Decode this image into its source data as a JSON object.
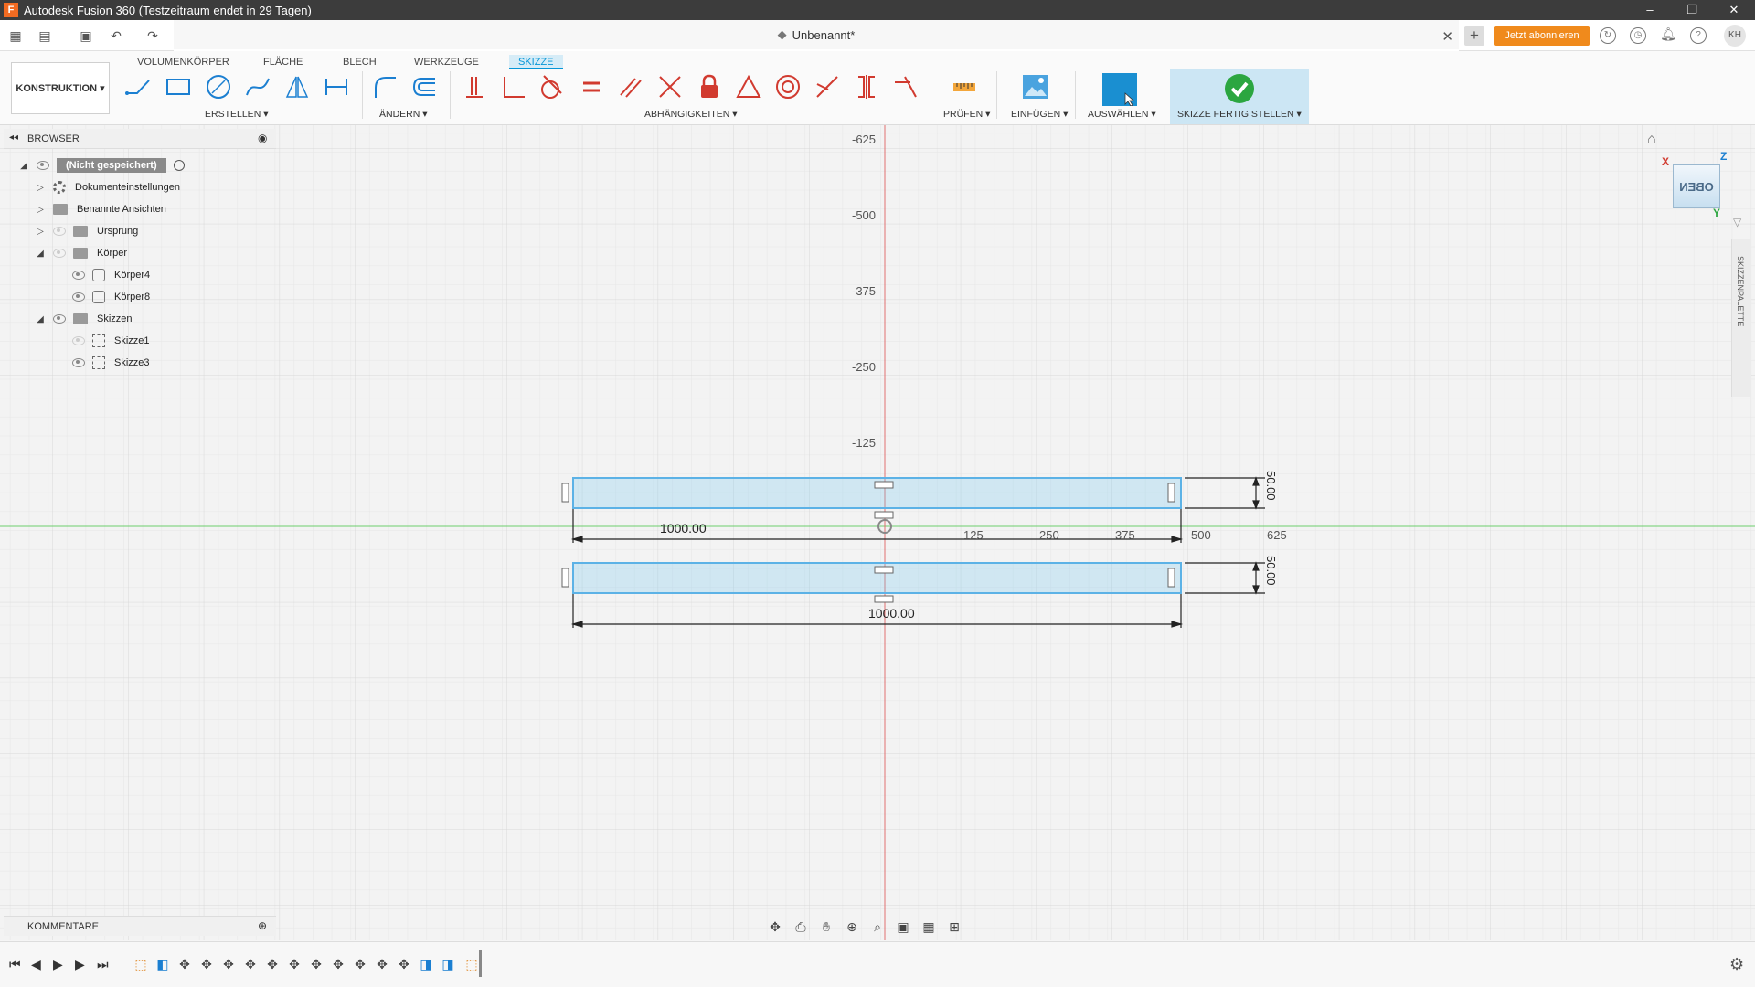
{
  "app": {
    "title": "Autodesk Fusion 360 (Testzeitraum endet in 29 Tagen)",
    "logo_letter": "F"
  },
  "window_controls": {
    "minimize": "–",
    "restore": "❐",
    "close": "✕"
  },
  "document": {
    "name": "Unbenannt*",
    "close": "✕"
  },
  "header": {
    "subscribe_label": "Jetzt abonnieren",
    "user_initials": "KH",
    "new_tab": "+"
  },
  "ribbon": {
    "tabs": [
      "VOLUMENKÖRPER",
      "FLÄCHE",
      "BLECH",
      "WERKZEUGE",
      "SKIZZE"
    ],
    "active_tab": "SKIZZE",
    "workspace": "KONSTRUKTION ▾",
    "groups": {
      "create": "ERSTELLEN ▾",
      "modify": "ÄNDERN ▾",
      "constraints": "ABHÄNGIGKEITEN ▾",
      "inspect": "PRÜFEN ▾",
      "insert": "EINFÜGEN ▾",
      "select": "AUSWÄHLEN ▾",
      "finish": "SKIZZE FERTIG STELLEN ▾"
    }
  },
  "browser": {
    "title": "BROWSER",
    "items": [
      {
        "label": "(Nicht gespeichert)",
        "level": 0
      },
      {
        "label": "Dokumenteinstellungen",
        "level": 1
      },
      {
        "label": "Benannte Ansichten",
        "level": 1
      },
      {
        "label": "Ursprung",
        "level": 1
      },
      {
        "label": "Körper",
        "level": 1
      },
      {
        "label": "Körper4",
        "level": 2
      },
      {
        "label": "Körper8",
        "level": 2
      },
      {
        "label": "Skizzen",
        "level": 1
      },
      {
        "label": "Skizze1",
        "level": 2
      },
      {
        "label": "Skizze3",
        "level": 2
      }
    ]
  },
  "comments": {
    "title": "KOMMENTARE"
  },
  "right_palette": {
    "label": "SKIZZENPALETTE"
  },
  "viewcube": {
    "face": "OBEN",
    "x_axis": "X",
    "y_axis": "Y",
    "z_axis": "Z"
  },
  "canvas": {
    "y_ticks": [
      "-625",
      "-500",
      "-375",
      "-250",
      "-125"
    ],
    "x_ticks": [
      "125",
      "250",
      "375",
      "500",
      "625"
    ],
    "dimensions": {
      "width_top": "1000.00",
      "width_bottom": "1000.00",
      "height_top": "50.00",
      "height_bottom": "50.00"
    }
  }
}
